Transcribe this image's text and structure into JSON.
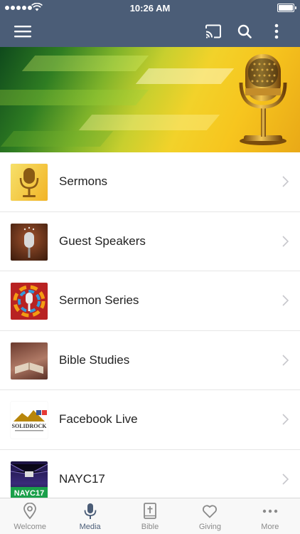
{
  "status_bar": {
    "time": "10:26 AM"
  },
  "colors": {
    "nav_bg": "#4b5d77",
    "active_tab": "#4b5d77",
    "inactive_tab": "#8a8a8a"
  },
  "navbar": {
    "menu_icon": "hamburger-menu-icon",
    "actions": [
      "cast-icon",
      "search-icon",
      "more-vertical-icon"
    ]
  },
  "media_list": [
    {
      "label": "Sermons",
      "thumb_icon": "golden-microphone-thumbnail"
    },
    {
      "label": "Guest Speakers",
      "thumb_icon": "vintage-microphone-thumbnail"
    },
    {
      "label": "Sermon Series",
      "thumb_icon": "colorful-microphone-thumbnail"
    },
    {
      "label": "Bible Studies",
      "thumb_icon": "open-bible-thumbnail"
    },
    {
      "label": "Facebook Live",
      "thumb_icon": "solid-rock-logo-thumbnail",
      "thumb_text": "SOLIDROCK"
    },
    {
      "label": "NAYC17",
      "thumb_icon": "nayc17-thumbnail",
      "thumb_text": "NAYC17"
    }
  ],
  "tabbar": {
    "tabs": [
      {
        "label": "Welcome",
        "icon": "location-pin-icon"
      },
      {
        "label": "Media",
        "icon": "microphone-icon",
        "active": true
      },
      {
        "label": "Bible",
        "icon": "bible-icon"
      },
      {
        "label": "Giving",
        "icon": "heart-icon"
      },
      {
        "label": "More",
        "icon": "more-horizontal-icon"
      }
    ]
  }
}
